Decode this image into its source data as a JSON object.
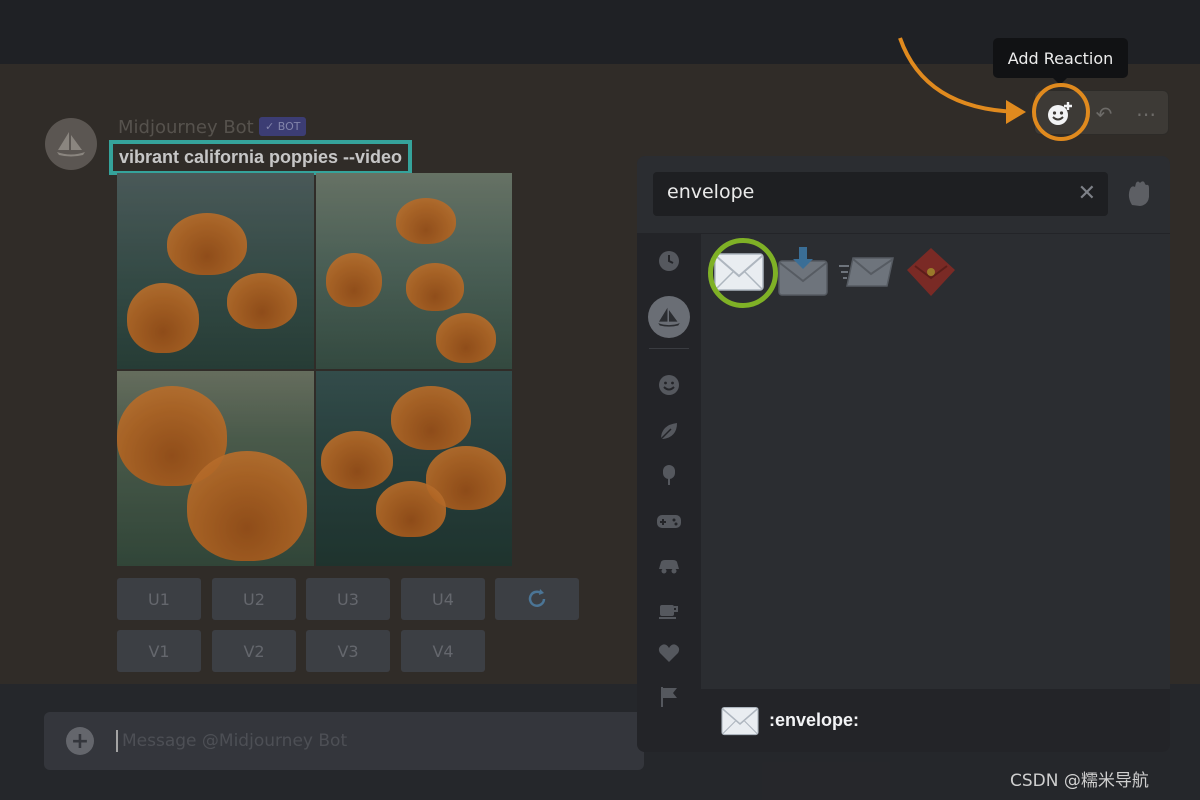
{
  "message": {
    "username": "Midjourney Bot",
    "badge": "✓ BOT",
    "prompt": "vibrant california poppies --video",
    "buttons_row1": [
      "U1",
      "U2",
      "U3",
      "U4"
    ],
    "buttons_row2": [
      "V1",
      "V2",
      "V3",
      "V4"
    ]
  },
  "composer": {
    "placeholder": "Message @Midjourney Bot"
  },
  "toolbar": {
    "tooltip": "Add Reaction",
    "add_reaction_icon": "add-reaction-icon",
    "reply_icon": "reply-icon",
    "more_icon": "more-icon"
  },
  "picker": {
    "search_value": "envelope",
    "clear_icon": "close-icon",
    "results": [
      "envelope",
      "envelope-with-arrow",
      "incoming-envelope",
      "red-envelope"
    ],
    "footer_name": ":envelope:"
  },
  "colors": {
    "highlight_teal": "#41c7bd",
    "highlight_orange": "#e08a1e",
    "highlight_green": "#7fb126"
  },
  "watermark": "CSDN @糯米导航"
}
